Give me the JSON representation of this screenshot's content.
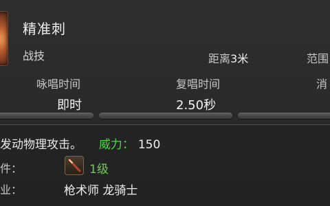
{
  "skill": {
    "name": "精准刺",
    "category": "战技",
    "range_label": "距离",
    "range_value": "3米",
    "radius_label": "范围"
  },
  "stats": {
    "cast_label": "咏唱时间",
    "cast_value": "即时",
    "recast_label": "复唱时间",
    "recast_value": "2.50秒",
    "cost_label": "消"
  },
  "description": {
    "text": "发动物理攻击。",
    "potency_label": "威力",
    "potency_colon": "：",
    "potency_value": "150"
  },
  "requirements": {
    "acquire_label": "件：",
    "level": "1级",
    "class_label": "业：",
    "class_value": "枪术师 龙骑士"
  },
  "colors": {
    "potency_label": "#4fd64a",
    "level": "#76c85a"
  }
}
